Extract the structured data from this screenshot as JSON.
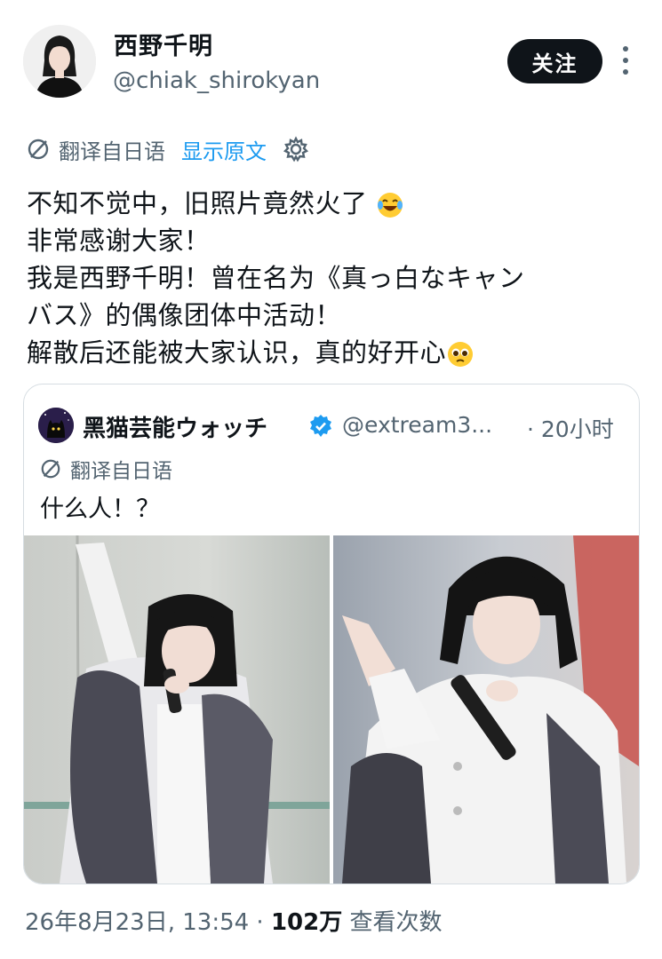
{
  "author": {
    "display_name": "西野千明",
    "handle": "@chiak_shirokyan",
    "follow_label": "关注"
  },
  "translate_bar": {
    "label": "翻译自日语",
    "show_original": "显示原文"
  },
  "tweet": {
    "lines": [
      "不知不觉中，旧照片竟然火了",
      "非常感谢大家！",
      "我是西野千明！曾在名为《真っ白なキャン",
      "バス》的偶像团体中活动！",
      "解散后还能被大家认识，真的好开心"
    ],
    "emojis": [
      "laughing-tears-emoji",
      "pleading-face-emoji"
    ]
  },
  "quote": {
    "display_name": "黑猫芸能ウォッチ",
    "handle": "@extream3...",
    "time": "· 20小时",
    "translate_label": "翻译自日语",
    "text": "什么人！？",
    "photos": [
      "performer-photo-left",
      "performer-photo-right"
    ]
  },
  "meta": {
    "datetime": "26年8月23日, 13:54 · ",
    "views_count": "102万",
    "views_label": " 查看次数"
  },
  "colors": {
    "text": "#0f1419",
    "secondary": "#536471",
    "link": "#1d9bf0",
    "button_bg": "#0f1419"
  }
}
